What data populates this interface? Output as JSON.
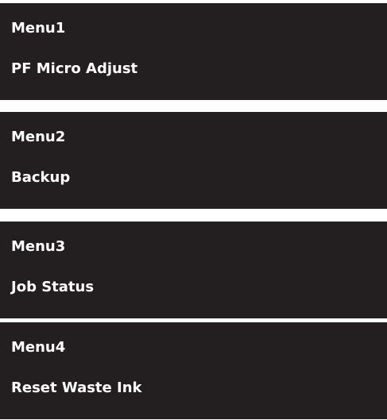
{
  "menus": [
    {
      "title": "Menu1",
      "item": "PF Micro Adjust"
    },
    {
      "title": "Menu2",
      "item": "Backup"
    },
    {
      "title": "Menu3",
      "item": "Job Status"
    },
    {
      "title": "Menu4",
      "item": "Reset Waste Ink"
    }
  ],
  "colors": {
    "panel_background": "#231f20",
    "text": "#ffffff",
    "page_background": "#ffffff"
  }
}
